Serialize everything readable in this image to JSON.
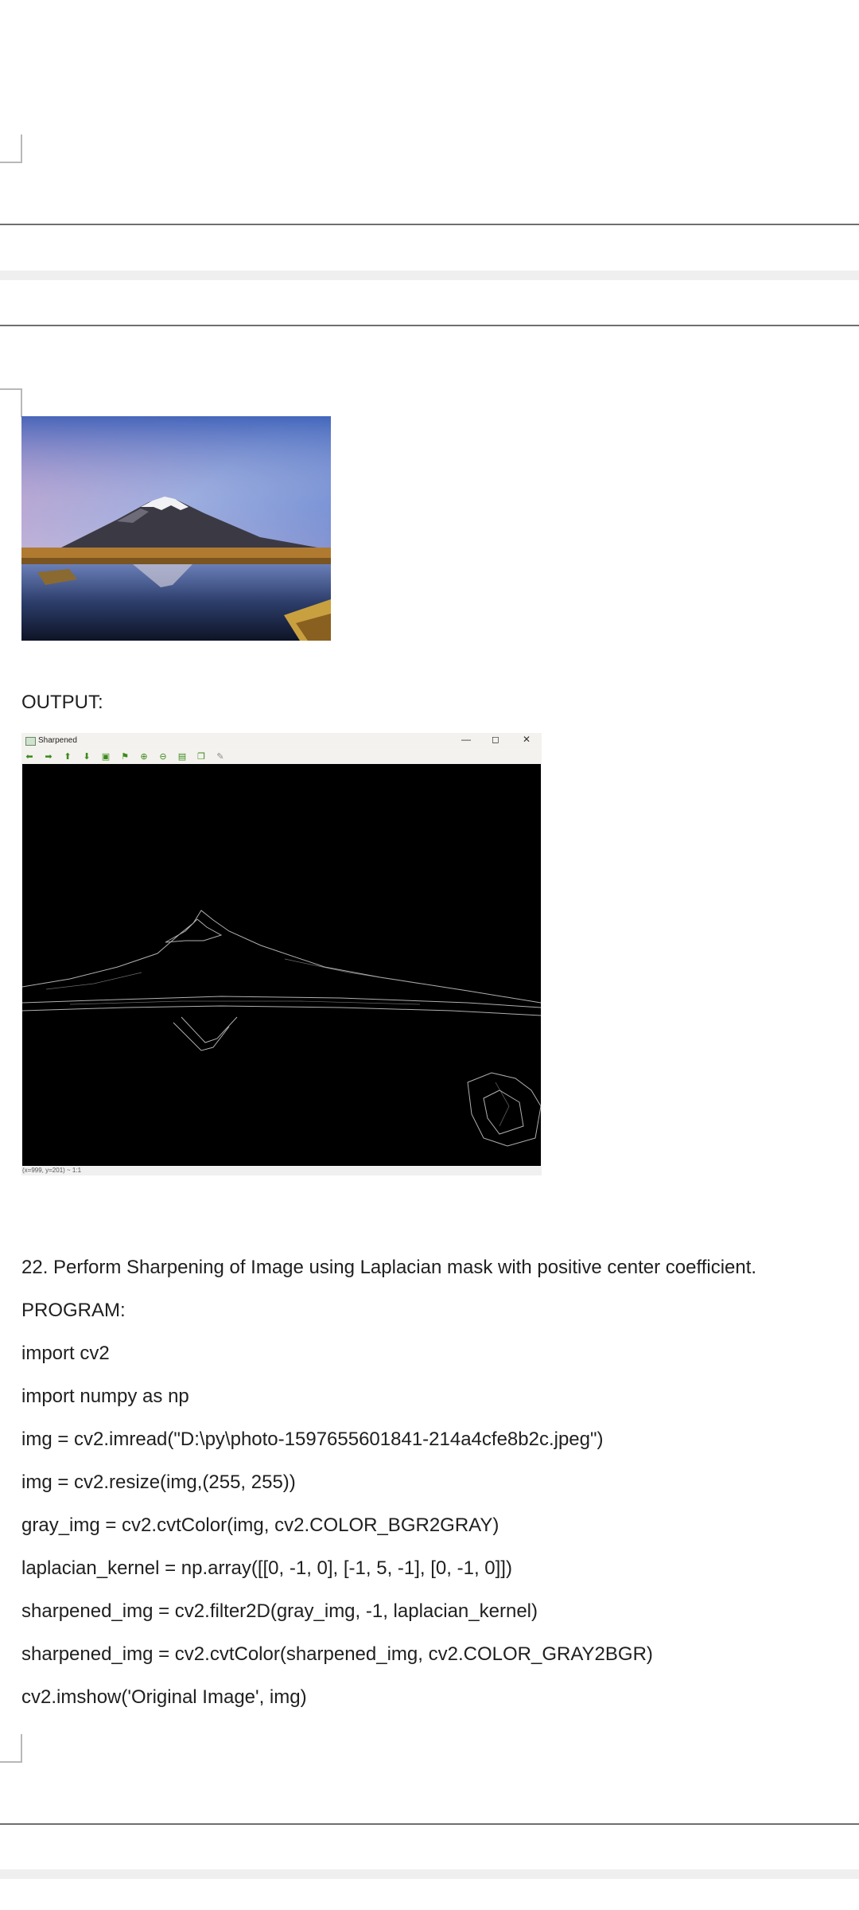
{
  "document": {
    "output_label": "OUTPUT:",
    "question": "22. Perform Sharpening of Image using Laplacian mask with positive center coefficient.",
    "program_label": "PROGRAM:",
    "code_lines": [
      "import cv2",
      "import numpy as np",
      "img = cv2.imread(\"D:\\py\\photo-1597655601841-214a4cfe8b2c.jpeg\")",
      "img = cv2.resize(img,(255, 255))",
      "gray_img = cv2.cvtColor(img, cv2.COLOR_BGR2GRAY)",
      "laplacian_kernel = np.array([[0, -1, 0], [-1, 5, -1], [0, -1, 0]])",
      "sharpened_img = cv2.filter2D(gray_img, -1, laplacian_kernel)",
      "sharpened_img = cv2.cvtColor(sharpened_img, cv2.COLOR_GRAY2BGR)",
      "cv2.imshow('Original Image', img)"
    ]
  },
  "output_window": {
    "title": "Sharpened",
    "minimize": "—",
    "maximize": "◻",
    "close": "✕",
    "status": "(x=999, y=201) ~ 1:1",
    "toolbar_icons": [
      "arrow-left-icon",
      "arrow-right-icon",
      "arrow-up-icon",
      "arrow-down-icon",
      "image-icon",
      "properties-icon",
      "zoom-in-icon",
      "zoom-out-icon",
      "save-icon",
      "copy-icon",
      "brush-icon"
    ]
  },
  "colors": {
    "divider": "#6f6f6f",
    "page_gap": "#efefef",
    "toolbar_green": "#3a8a1a"
  }
}
